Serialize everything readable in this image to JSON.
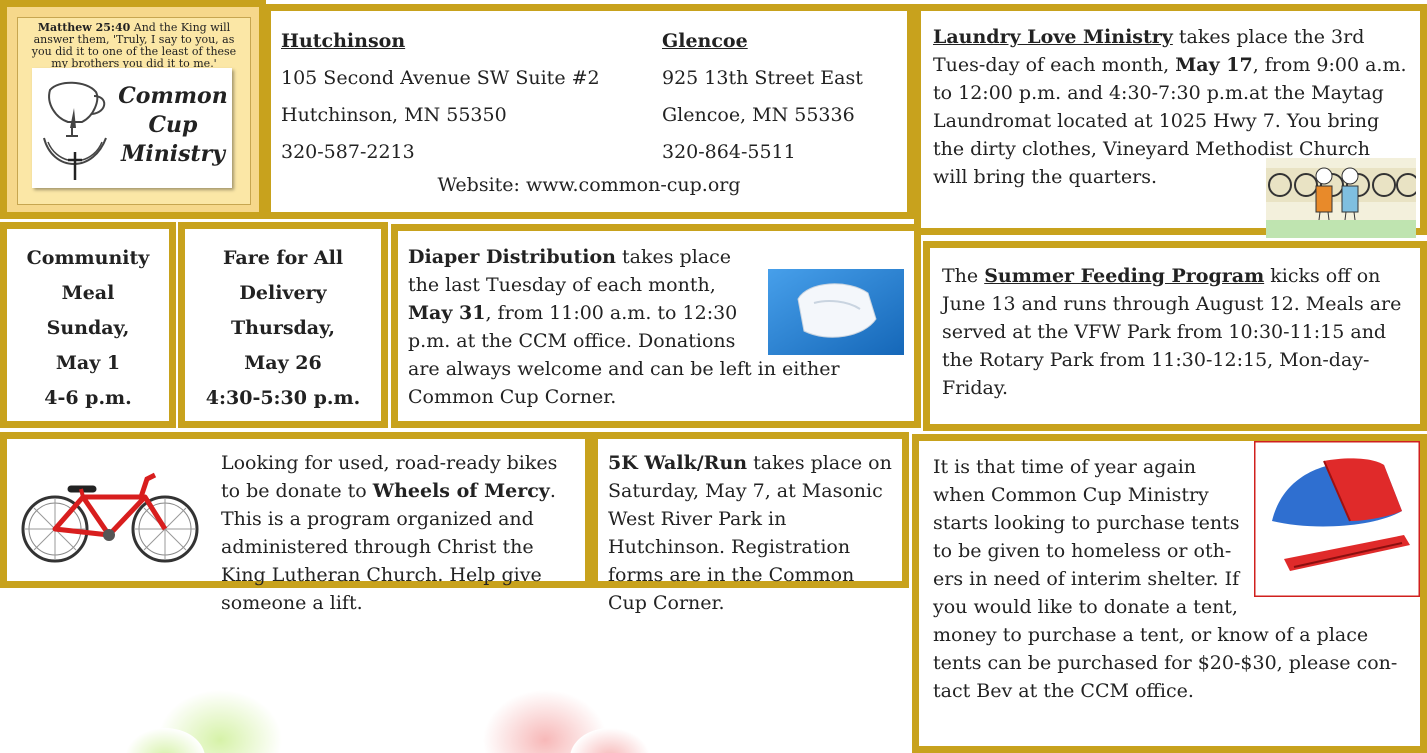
{
  "logo": {
    "verse_ref": "Matthew 25:40",
    "verse_text": "And the King will answer them, 'Truly, I say to you, as you did it to one of the least of these my brothers you did it to me.'",
    "title_lines": [
      "Common",
      "Cup",
      "Ministry"
    ]
  },
  "address": {
    "hutchinson": {
      "name": "Hutchinson",
      "street": "105 Second Avenue SW Suite #2",
      "city": "Hutchinson, MN   55350",
      "phone": "320-587-2213"
    },
    "glencoe": {
      "name": "Glencoe",
      "street": "925 13th Street East",
      "city": "Glencoe, MN   55336",
      "phone": "320-864-5511"
    },
    "website": "Website:  www.common-cup.org"
  },
  "laundry": {
    "title": "Laundry Love Ministry",
    "p1": " takes place the 3rd Tues-day of each month, ",
    "date": "May 17",
    "p2": ", from 9:00 a.m. to 12:00 p.m. and 4:30-7:30 p.m.at the Maytag Laundromat located at 1025 Hwy 7.  You bring the dirty clothes, Vineyard  Methodist Church will  bring the quarters."
  },
  "meal": {
    "lines": [
      "Community",
      "Meal",
      "Sunday,",
      "May 1",
      "4-6 p.m."
    ]
  },
  "fare": {
    "lines": [
      "Fare for All",
      "Delivery",
      "Thursday,",
      "May 26",
      "4:30-5:30 p.m."
    ]
  },
  "diaper": {
    "title": "Diaper Distribution",
    "p1": " takes place the last Tuesday of each month, ",
    "date": "May 31",
    "p2": ", from 11:00 a.m. to 12:30 p.m. at the CCM office.  Donations are always welcome and can be left in either Common Cup Corner."
  },
  "summer": {
    "pre": "The ",
    "title": "Summer Feeding Program",
    "p1": " kicks off on June 13 and runs through August 12.  Meals are served at the VFW Park from 10:30-11:15 and the Rotary Park from 11:30-12:15, Mon-day-Friday."
  },
  "bike": {
    "p1": "Looking for used, road-ready bikes to be donate to ",
    "program": "Wheels of Mercy",
    "p2": ". This is a program organized and administered through Christ the King Lutheran Church.  Help give someone a lift."
  },
  "walk": {
    "title": "5K Walk/Run",
    "p1": " takes place on  Saturday, May 7, at Masonic West River Park in Hutchinson.  Registration forms are in the Common Cup Corner."
  },
  "tents": {
    "text": "It is that time of year again when Common Cup Ministry starts looking to purchase tents to be given to homeless or oth-ers in need of interim shelter.  If you would like to donate a tent, money to purchase a tent, or know of a place tents can be purchased for $20-$30, please con-tact Bev at the CCM office."
  }
}
